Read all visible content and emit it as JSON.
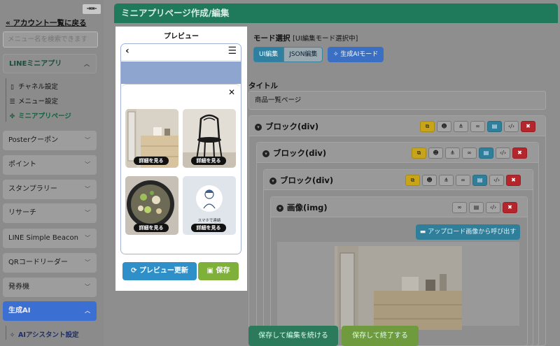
{
  "sidebar": {
    "collapse_icon": "⇥⇤",
    "back_label": "アカウント一覧に戻る",
    "search_placeholder": "メニュー名を検索できます",
    "sections": [
      {
        "label": "LINEミニアプリ",
        "expanded": true
      },
      {
        "label": "Posterクーポン"
      },
      {
        "label": "ポイント"
      },
      {
        "label": "スタンプラリー"
      },
      {
        "label": "リサーチ"
      },
      {
        "label": "LINE Simple Beacon"
      },
      {
        "label": "QRコードリーダー"
      },
      {
        "label": "発券機"
      },
      {
        "label": "生成AI",
        "highlight": true
      }
    ],
    "mini_app_items": [
      {
        "label": "チャネル設定",
        "icon": "phone-icon"
      },
      {
        "label": "メニュー設定",
        "icon": "list-icon"
      },
      {
        "label": "ミニアプリページ",
        "icon": "puzzle-icon",
        "current": true
      }
    ],
    "ai_items": [
      {
        "label": "AIアシスタント設定",
        "icon": "sparkle-icon"
      }
    ]
  },
  "header": {
    "title": "ミニアプリページ作成/編集"
  },
  "preview": {
    "title": "プレビュー",
    "cards": [
      {
        "button": "詳細を見る",
        "image": "dresser-photo"
      },
      {
        "button": "詳細を見る",
        "image": "chair-photo"
      },
      {
        "button": "詳細を見る",
        "image": "food-photo"
      },
      {
        "button": "詳細を見る",
        "image": "person-illustration",
        "caption": "スマホで連絡"
      }
    ],
    "refresh_label": "プレビュー更新",
    "save_label": "保存"
  },
  "mode": {
    "label": "モード選択",
    "note": "[UI編集モード選択中]",
    "options": [
      "UI編集",
      "JSON編集"
    ],
    "selected": "UI編集",
    "ai_label": "生成AIモード"
  },
  "title_field": {
    "label": "タイトル",
    "value": "商品一覧ページ"
  },
  "blocks": [
    {
      "label": "ブロック(div)"
    },
    {
      "label": "ブロック(div)"
    },
    {
      "label": "ブロック(div)"
    },
    {
      "label": "画像(img)"
    }
  ],
  "upload_label": "アップロード画像から呼び出す",
  "footer": {
    "continue_label": "保存して編集を続ける",
    "finish_label": "保存して終了する"
  },
  "colors": {
    "header": "#1f7a5c",
    "accent_green": "#7fb13a",
    "accent_blue": "#2f8fc8",
    "ai_purple": "#3b6fd2",
    "danger": "#b5262c"
  }
}
